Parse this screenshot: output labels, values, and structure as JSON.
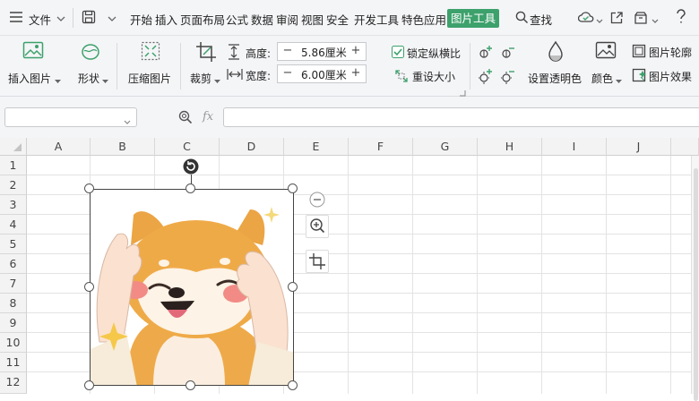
{
  "menubar": {
    "file_label": "文件",
    "tabs": [
      {
        "label": "开始"
      },
      {
        "label": "插入"
      },
      {
        "label": "页面布局"
      },
      {
        "label": "公式"
      },
      {
        "label": "数据"
      },
      {
        "label": "审阅"
      },
      {
        "label": "视图"
      },
      {
        "label": "安全"
      },
      {
        "label": "开发工具"
      },
      {
        "label": "特色应用"
      }
    ],
    "active_tab": "图片工具",
    "search_label": "查找",
    "accent_color": "#3da16c"
  },
  "ribbon": {
    "insert_picture": "插入图片",
    "shape": "形状",
    "compress_picture": "压缩图片",
    "crop": "裁剪",
    "height_label": "高度:",
    "height_value": "5.86厘米",
    "width_label": "宽度:",
    "width_value": "6.00厘米",
    "lock_ratio": "锁定纵横比",
    "lock_ratio_checked": true,
    "reset_size": "重设大小",
    "set_transparency": "设置透明色",
    "color": "颜色",
    "picture_outline": "图片轮廓",
    "picture_effect": "图片效果"
  },
  "formula_bar": {
    "name_box_value": "",
    "fx_label": "fx",
    "formula_value": ""
  },
  "grid": {
    "columns": [
      "A",
      "B",
      "C",
      "D",
      "E",
      "F",
      "G",
      "H",
      "I",
      "J"
    ],
    "rows": [
      "1",
      "2",
      "3",
      "4",
      "5",
      "6",
      "7",
      "8",
      "9",
      "10",
      "11",
      "12"
    ]
  }
}
